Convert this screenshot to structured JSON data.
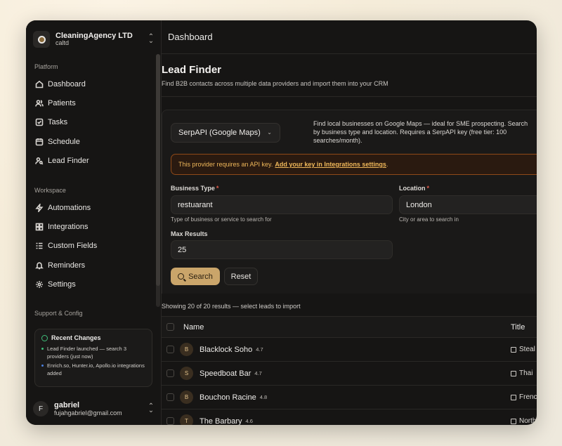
{
  "org": {
    "name": "CleaningAgency LTD",
    "slug": "caltd"
  },
  "sidebar": {
    "platform_label": "Platform",
    "platform_items": [
      {
        "label": "Dashboard",
        "icon": "home-icon"
      },
      {
        "label": "Patients",
        "icon": "users-icon"
      },
      {
        "label": "Tasks",
        "icon": "check-square-icon"
      },
      {
        "label": "Schedule",
        "icon": "calendar-icon"
      },
      {
        "label": "Lead Finder",
        "icon": "user-search-icon"
      }
    ],
    "workspace_label": "Workspace",
    "workspace_items": [
      {
        "label": "Automations",
        "icon": "zap-icon"
      },
      {
        "label": "Integrations",
        "icon": "puzzle-icon"
      },
      {
        "label": "Custom Fields",
        "icon": "list-icon"
      },
      {
        "label": "Reminders",
        "icon": "bell-icon"
      },
      {
        "label": "Settings",
        "icon": "gear-icon"
      }
    ],
    "support_label": "Support & Config",
    "changes": {
      "title": "Recent Changes",
      "items": [
        {
          "text": "Lead Finder launched — search 3 providers (just now)",
          "color": "#3fbf7a"
        },
        {
          "text": "Enrich.so, Hunter.io, Apollo.io integrations added",
          "color": "#4a7fe0"
        }
      ]
    },
    "user": {
      "initial": "F",
      "name": "gabriel",
      "email": "fujahgabriel@gmail.com"
    }
  },
  "header": {
    "title": "Dashboard"
  },
  "page": {
    "title": "Lead Finder",
    "subtitle": "Find B2B contacts across multiple data providers and import them into your CRM"
  },
  "provider": {
    "selected": "SerpAPI (Google Maps)",
    "description_lines": [
      "Find local businesses on Google Maps — ideal for SME prospecting. Search",
      "by business type and location. Requires a SerpAPI key (free tier: 100",
      "searches/month)."
    ]
  },
  "alert": {
    "text": "This provider requires an API key.",
    "link": "Add your key in Integrations settings",
    "tail": "."
  },
  "form": {
    "business_type": {
      "label": "Business Type",
      "value": "restuarant",
      "help": "Type of business or service to search for"
    },
    "location": {
      "label": "Location",
      "value": "London",
      "help": "City or area to search in"
    },
    "max_results": {
      "label": "Max Results",
      "value": "25"
    },
    "required_mark": "*",
    "search_label": "Search",
    "reset_label": "Reset"
  },
  "results": {
    "info": "Showing 20 of 20 results — select leads to import",
    "columns": [
      "Name",
      "Title"
    ],
    "rows": [
      {
        "initial": "B",
        "name": "Blacklock Soho",
        "rating": "4.7",
        "title": "Steal"
      },
      {
        "initial": "S",
        "name": "Speedboat Bar",
        "rating": "4.7",
        "title": "Thai"
      },
      {
        "initial": "B",
        "name": "Bouchon Racine",
        "rating": "4.8",
        "title": "Frenc"
      },
      {
        "initial": "T",
        "name": "The Barbary",
        "rating": "4.6",
        "title": "North"
      }
    ]
  },
  "colors": {
    "accent": "#caa56a",
    "warning": "#f0b85a",
    "background": "#161514"
  }
}
